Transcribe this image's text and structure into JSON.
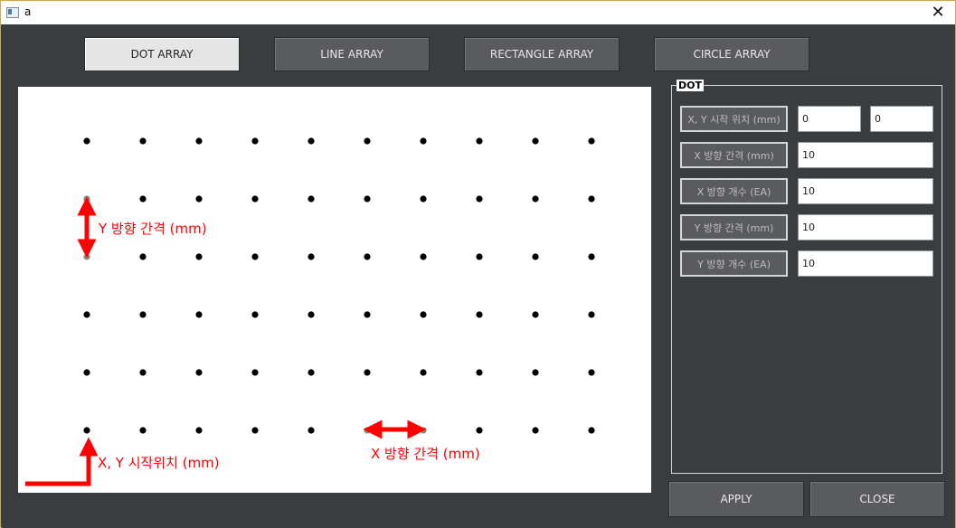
{
  "window": {
    "title": "a",
    "close_glyph": "✕"
  },
  "tabs": [
    {
      "label": "DOT ARRAY",
      "active": true
    },
    {
      "label": "LINE ARRAY",
      "active": false
    },
    {
      "label": "RECTANGLE ARRAY",
      "active": false
    },
    {
      "label": "CIRCLE ARRAY",
      "active": false
    }
  ],
  "canvas": {
    "annotations": {
      "y_spacing": "Y 방향 간격 (mm)",
      "x_spacing": "X 방향 간격 (mm)",
      "start": "X, Y 시작위치 (mm)"
    },
    "grid": {
      "columns": 10,
      "rows": 6
    },
    "colors": {
      "dot": "#000000",
      "highlight_dot": "#888888",
      "arrow": "#ff0000"
    }
  },
  "dot_group": {
    "title": "DOT",
    "start_label": "X, Y 시작 위치 (mm)",
    "start_x": "0",
    "start_y": "0",
    "x_spacing_label": "X 방향 간격 (mm)",
    "x_spacing": "10",
    "x_count_label": "X 방향 개수 (EA)",
    "x_count": "10",
    "y_spacing_label": "Y 방향 간격 (mm)",
    "y_spacing": "10",
    "y_count_label": "Y 방향 개수 (EA)",
    "y_count": "10"
  },
  "buttons": {
    "apply": "APPLY",
    "close": "CLOSE"
  }
}
